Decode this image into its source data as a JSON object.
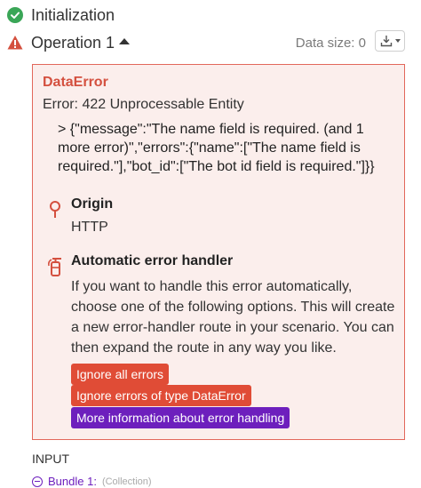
{
  "initialization": {
    "label": "Initialization",
    "status": "success"
  },
  "operation": {
    "label": "Operation 1",
    "status": "error",
    "data_size_label": "Data size: 0"
  },
  "error_panel": {
    "title": "DataError",
    "subtitle": "Error: 422 Unprocessable Entity",
    "body_lines": [
      "> {\"message\":\"The name field is required. (and 1",
      "more error)\",\"errors\":{\"name\":[\"The name field is",
      "required.\"],\"bot_id\":[\"The bot id field is required.\"]}}"
    ],
    "origin": {
      "title": "Origin",
      "value": "HTTP"
    },
    "handler": {
      "title": "Automatic error handler",
      "description": "If you want to handle this error automatically, choose one of the following options. This will create a new error-handler route in your scenario. You can then expand the route in any way you like.",
      "buttons": [
        {
          "label": "Ignore all errors",
          "style": "red"
        },
        {
          "label": "Ignore errors of type DataError",
          "style": "red"
        },
        {
          "label": "More information about error handling",
          "style": "purple"
        }
      ]
    }
  },
  "input": {
    "label": "INPUT",
    "bundle": {
      "label": "Bundle 1:",
      "type": "(Collection)"
    }
  },
  "colors": {
    "success_green": "#3aa657",
    "error_red": "#d4503f",
    "panel_bg": "#fbeeec",
    "panel_border": "#e2675b",
    "button_red": "#e04c36",
    "button_purple": "#6d1fbd"
  }
}
